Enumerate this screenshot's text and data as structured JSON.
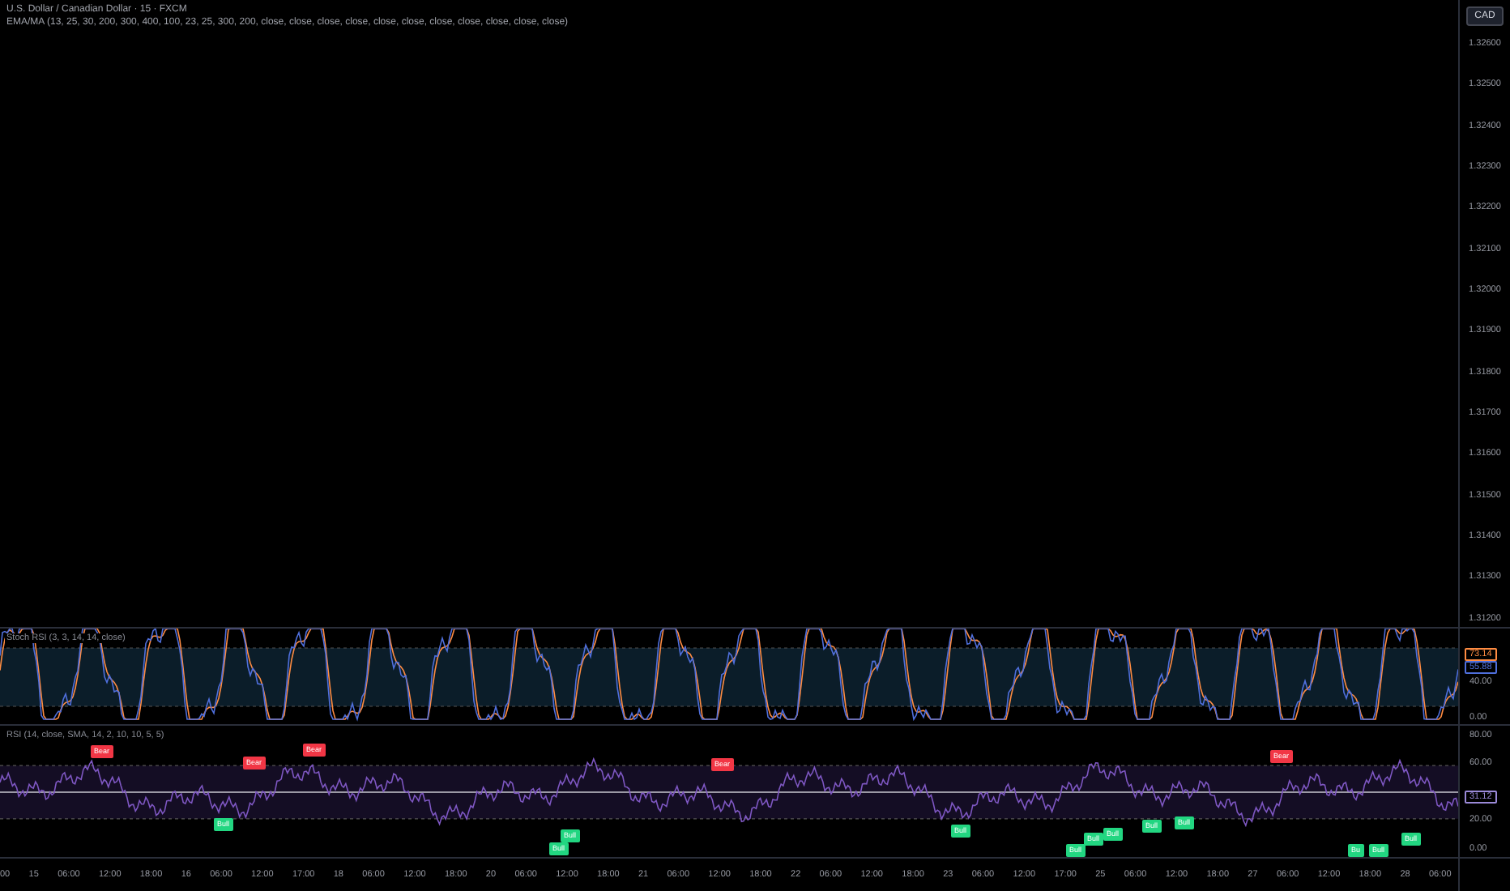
{
  "legend": {
    "symbol": "U.S. Dollar / Canadian Dollar · 15 · FXCM",
    "indicator": "EMA/MA (13, 25, 30, 200, 300, 400, 100, 23, 25, 300, 200, close, close, close, close, close, close, close, close, close, close, close)"
  },
  "currency_button": "CAD",
  "price_axis": [
    "1.32600",
    "1.32500",
    "1.32400",
    "1.32300",
    "1.32200",
    "1.32100",
    "1.32000",
    "1.31900",
    "1.31800",
    "1.31700",
    "1.31600",
    "1.31500",
    "1.31400",
    "1.31300",
    "1.31200"
  ],
  "stoch_pane": {
    "title": "Stoch RSI (3, 3, 14, 14, close)",
    "k_value": "73.14",
    "d_value": "55.88",
    "axis": [
      "40.00",
      "0.00"
    ]
  },
  "rsi_pane": {
    "title": "RSI (14, close, SMA, 14, 2, 10, 10, 5, 5)",
    "value": "31.12",
    "axis": [
      "80.00",
      "60.00",
      "20.00",
      "0.00"
    ],
    "signals": [
      {
        "kind": "bear",
        "label": "Bear"
      },
      {
        "kind": "bear",
        "label": "Bear"
      },
      {
        "kind": "bear",
        "label": "Bear"
      },
      {
        "kind": "bear",
        "label": "Bear"
      },
      {
        "kind": "bear",
        "label": "Bear"
      },
      {
        "kind": "bull",
        "label": "Bull"
      },
      {
        "kind": "bull",
        "label": "Bull"
      },
      {
        "kind": "bull",
        "label": "Bull"
      },
      {
        "kind": "bull",
        "label": "Bull"
      },
      {
        "kind": "bull",
        "label": "Bull"
      },
      {
        "kind": "bull",
        "label": "Bull"
      },
      {
        "kind": "bull",
        "label": "Bull"
      },
      {
        "kind": "bull",
        "label": "Bull"
      },
      {
        "kind": "bull",
        "label": "Bull"
      },
      {
        "kind": "bull",
        "label": "Bu"
      },
      {
        "kind": "bull",
        "label": "Bull"
      },
      {
        "kind": "bull",
        "label": "Bull"
      }
    ]
  },
  "time_axis": [
    "00",
    "15",
    "06:00",
    "12:00",
    "18:00",
    "16",
    "06:00",
    "12:00",
    "17:00",
    "18",
    "06:00",
    "12:00",
    "18:00",
    "20",
    "06:00",
    "12:00",
    "18:00",
    "21",
    "06:00",
    "12:00",
    "18:00",
    "22",
    "06:00",
    "12:00",
    "18:00",
    "23",
    "06:00",
    "12:00",
    "17:00",
    "25",
    "06:00",
    "12:00",
    "18:00",
    "27",
    "06:00",
    "12:00",
    "18:00",
    "28",
    "06:00"
  ]
}
